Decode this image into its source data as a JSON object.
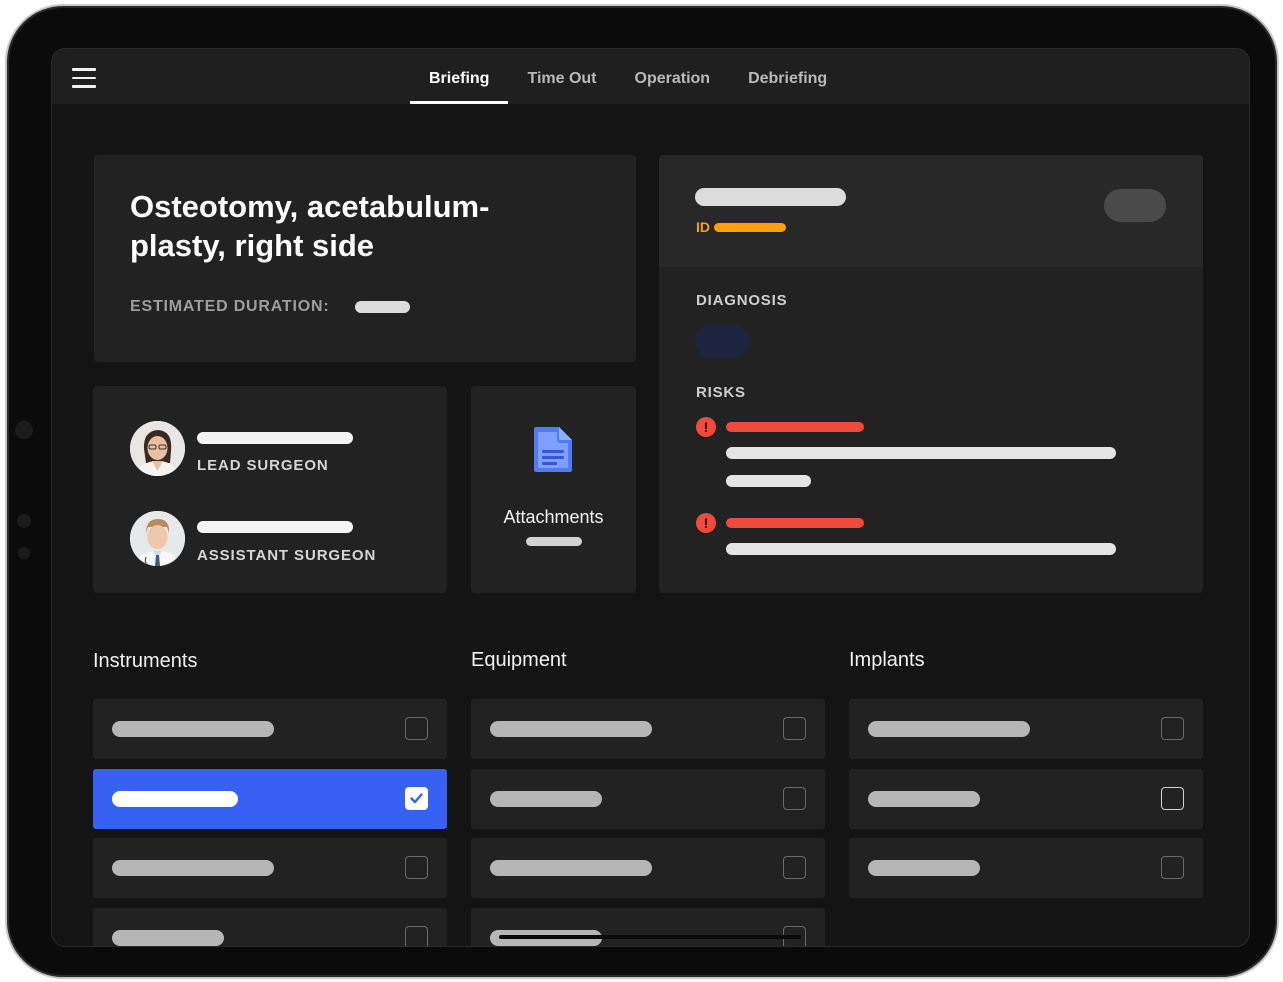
{
  "nav": {
    "tabs": [
      {
        "label": "Briefing",
        "active": true
      },
      {
        "label": "Time Out",
        "active": false
      },
      {
        "label": "Operation",
        "active": false
      },
      {
        "label": "Debriefing",
        "active": false
      }
    ]
  },
  "procedure": {
    "title": "Osteotomy, acetabulum-plasty, right side",
    "duration_label": "ESTIMATED DURATION:"
  },
  "surgeons": {
    "lead_label": "LEAD SURGEON",
    "assistant_label": "ASSISTANT SURGEON"
  },
  "attachments": {
    "label": "Attachments"
  },
  "patient": {
    "id_label": "ID",
    "diagnosis_label": "DIAGNOSIS",
    "risks_label": "RISKS"
  },
  "checklists": {
    "instruments": {
      "title": "Instruments",
      "items": [
        {
          "checked": false
        },
        {
          "checked": true
        },
        {
          "checked": false
        },
        {
          "checked": false
        }
      ]
    },
    "equipment": {
      "title": "Equipment",
      "items": [
        {
          "checked": false
        },
        {
          "checked": false
        },
        {
          "checked": false
        },
        {
          "checked": false
        }
      ]
    },
    "implants": {
      "title": "Implants",
      "items": [
        {
          "checked": false
        },
        {
          "checked": false
        },
        {
          "checked": false
        }
      ]
    }
  },
  "colors": {
    "accent_blue": "#3761f2",
    "risk_red": "#f04a3c",
    "id_orange": "#ff9f0a",
    "diagnosis_navy": "#1c2540"
  },
  "icons": {
    "menu": "hamburger-menu-icon",
    "attachment": "document-icon",
    "risk": "exclamation-icon",
    "check": "checkmark-icon"
  }
}
